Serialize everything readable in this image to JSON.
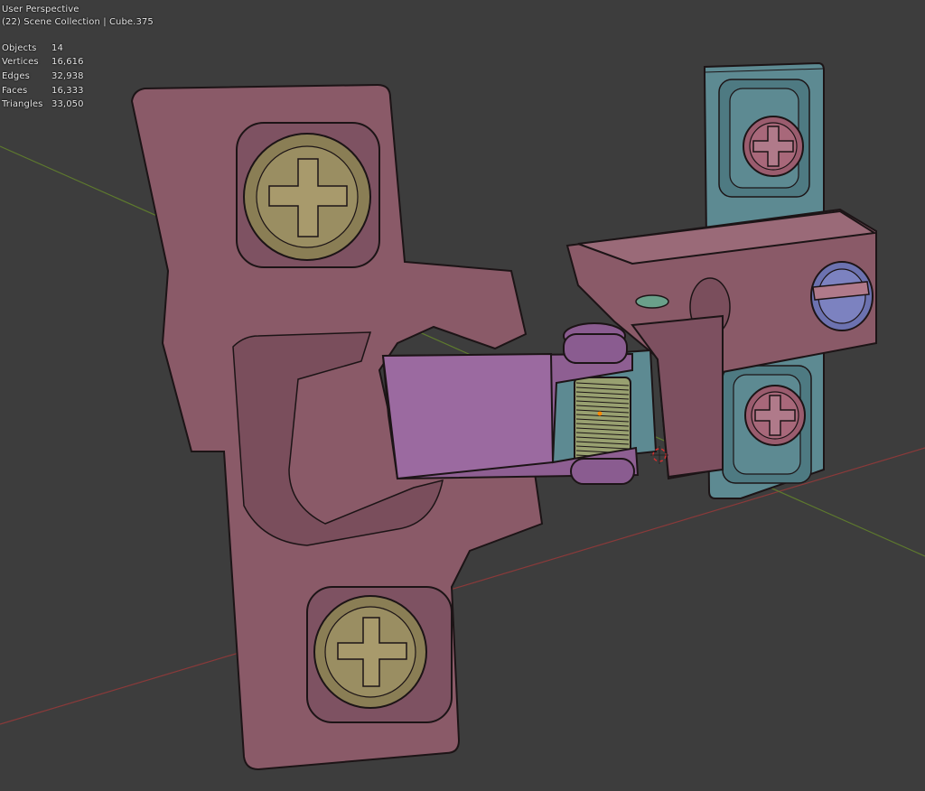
{
  "viewport": {
    "view_name": "User Perspective",
    "collection_info": "(22) Scene Collection | Cube.375"
  },
  "statistics": [
    {
      "label": "Objects",
      "value": "14"
    },
    {
      "label": "Vertices",
      "value": "16,616"
    },
    {
      "label": "Edges",
      "value": "32,938"
    },
    {
      "label": "Faces",
      "value": "16,333"
    },
    {
      "label": "Triangles",
      "value": "33,050"
    }
  ],
  "colors": {
    "background": "#3d3d3d",
    "x_axis": "#8a3a3a",
    "y_axis": "#5e7a2e",
    "hinge_body": "#8a5a68",
    "hinge_arm": "#8e5f92",
    "mount_plate": "#5d8a92",
    "screw_gold": "#8a7e55",
    "screw_pink": "#9a5c6e",
    "screw_blue": "#6c72b0",
    "spring_green": "#98a070",
    "wire": "#1c1416",
    "origin": "#ff8800",
    "cursor_red": "#d83030"
  },
  "objects": [
    "hinge-cup-plate",
    "hinge-arm",
    "mounting-plate",
    "hinge-spring",
    "screw-top",
    "screw-bottom",
    "screw-mount-top",
    "screw-mount-bottom",
    "screw-mount-side"
  ]
}
